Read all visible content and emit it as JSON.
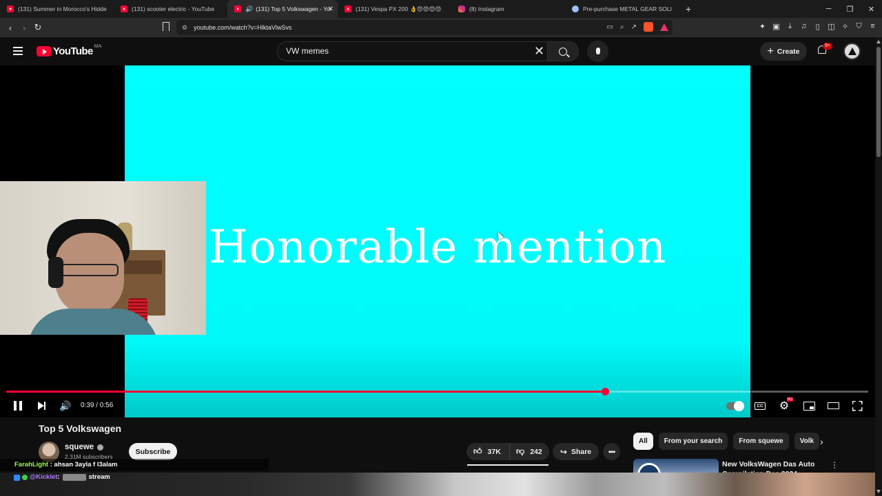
{
  "browser": {
    "tabs": [
      {
        "title": "(131) Summer in Morocco's Hidden S",
        "favicon": "youtube-icon",
        "active": false
      },
      {
        "title": "(131) scooter electric - YouTube",
        "favicon": "youtube-icon",
        "active": false
      },
      {
        "title": "(131) Top 5 Volkswagen - You",
        "favicon": "youtube-icon",
        "active": true,
        "audio": true
      },
      {
        "title": "(131) Vespa PX 200 👌😍😍😍😍",
        "favicon": "youtube-icon",
        "active": false
      },
      {
        "title": "(8) Instagram",
        "favicon": "instagram-icon",
        "active": false
      },
      {
        "title": "Pre-purchase METAL GEAR SOLID Δ",
        "favicon": "steam-icon",
        "active": false
      }
    ],
    "new_tab_label": "+",
    "url": "youtube.com/watch?v=HlktaVlwSvs"
  },
  "youtube": {
    "logo_text": "YouTube",
    "country_code": "MA",
    "search_query": "VW memes",
    "create_label": "Create",
    "notification_count": "9+"
  },
  "player": {
    "video_text": "Honorable mention",
    "time_display": "0:39 / 0:56",
    "progress": 0.695,
    "accent_color": "#ff0033",
    "video_bg_color": "#00ffff"
  },
  "video": {
    "title": "Top 5 Volkswagen",
    "channel_name": "squewe",
    "subscribers": "2.31M subscribers",
    "subscribe_label": "Subscribe",
    "likes": "37K",
    "dislikes": "242",
    "share_label": "Share"
  },
  "sidebar": {
    "chips": [
      "All",
      "From your search",
      "From squewe",
      "Volk"
    ],
    "recommendation": {
      "title": "New VolksWagen Das Auto Compilation Das 2024"
    }
  },
  "stream_chat": [
    {
      "user": "FarahLight",
      "separator": " : ",
      "message": "ahsan 3ayla f l3alam"
    },
    {
      "user": "@Kicklet",
      "separator": " : ",
      "message": "stream"
    }
  ]
}
